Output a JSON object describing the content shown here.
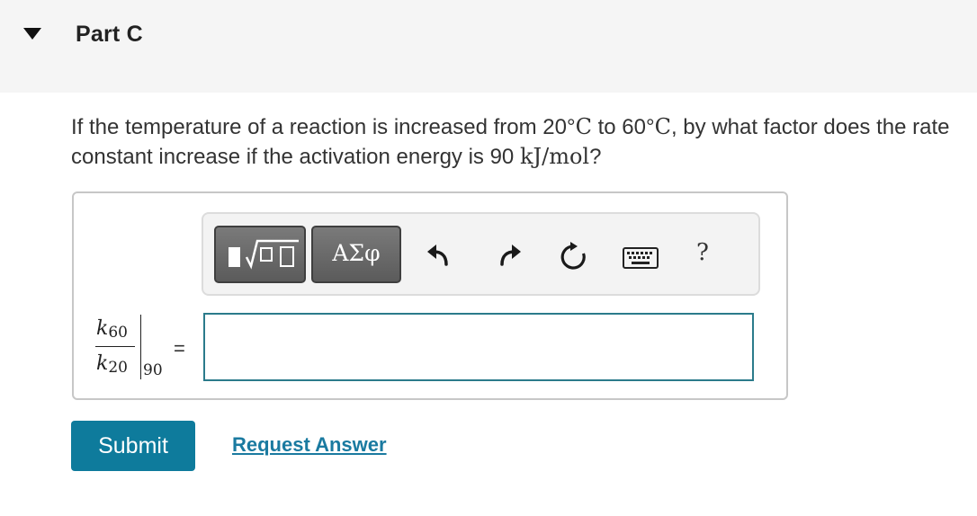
{
  "header": {
    "part_title": "Part C"
  },
  "question": {
    "text_1": "If the temperature of a reaction is increased from 20",
    "deg_1": "°",
    "unit_1": "C",
    "text_2": " to 60",
    "deg_2": "°",
    "unit_2": "C",
    "text_3": ", by what factor does the rate constant increase if the activation energy is 90 ",
    "unit_3": "kJ/mol",
    "text_4": "?"
  },
  "toolbar": {
    "templates_icon": "templates-icon",
    "greek_label": "ΑΣφ",
    "undo_icon": "undo-icon",
    "redo_icon": "redo-icon",
    "reset_icon": "reset-icon",
    "keyboard_icon": "keyboard-icon",
    "help_label": "?"
  },
  "expression": {
    "numerator_var": "k",
    "numerator_sub": "60",
    "denominator_var": "k",
    "denominator_sub": "20",
    "eval_sub": "90",
    "equals": "="
  },
  "answer": {
    "value": "",
    "placeholder": ""
  },
  "actions": {
    "submit_label": "Submit",
    "request_label": "Request Answer"
  },
  "colors": {
    "submit_bg": "#0e7b9c",
    "link": "#1a7aa0",
    "input_border": "#2b7b8b",
    "header_bg": "#f5f5f5"
  }
}
